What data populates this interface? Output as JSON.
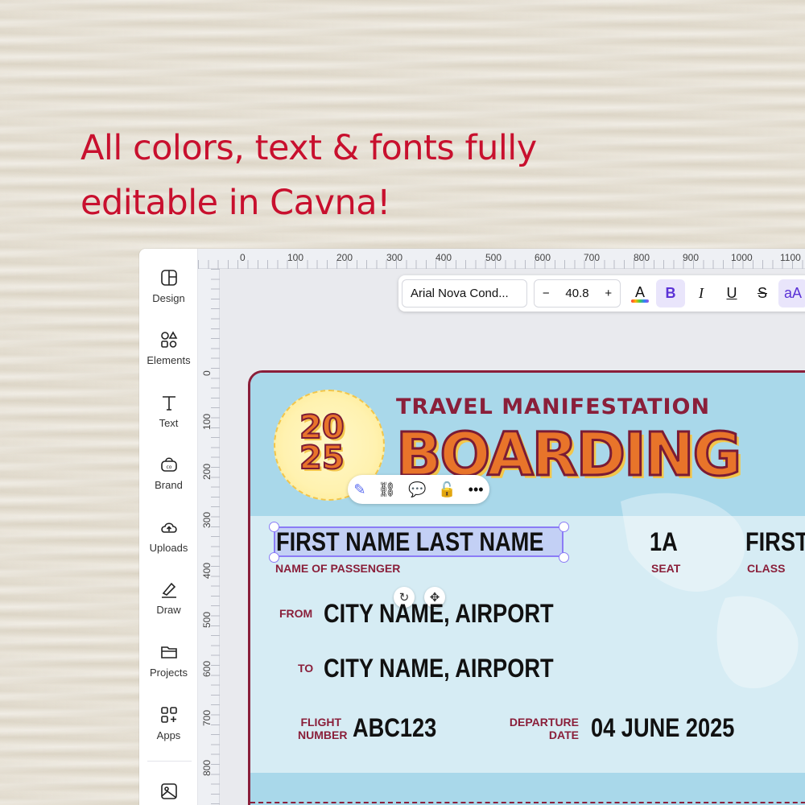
{
  "headline": "All colors, text & fonts fully editable in Cavna!",
  "sidebar": {
    "items": [
      {
        "label": "Design",
        "icon": "design-icon"
      },
      {
        "label": "Elements",
        "icon": "elements-icon"
      },
      {
        "label": "Text",
        "icon": "text-icon"
      },
      {
        "label": "Brand",
        "icon": "brand-icon"
      },
      {
        "label": "Uploads",
        "icon": "uploads-icon"
      },
      {
        "label": "Draw",
        "icon": "draw-icon"
      },
      {
        "label": "Projects",
        "icon": "projects-icon"
      },
      {
        "label": "Apps",
        "icon": "apps-icon"
      }
    ]
  },
  "ruler": {
    "top": [
      "0",
      "100",
      "200",
      "300",
      "400",
      "500",
      "600",
      "700",
      "800",
      "900",
      "1000",
      "1100"
    ],
    "left": [
      "0",
      "100",
      "200",
      "300",
      "400",
      "500",
      "600",
      "700",
      "800"
    ]
  },
  "toolbar": {
    "font_name": "Arial Nova Cond...",
    "minus": "−",
    "font_size": "40.8",
    "plus": "+",
    "color_letter": "A",
    "bold": "B",
    "italic": "I",
    "underline": "U",
    "strike": "S",
    "case": "aA"
  },
  "ticket": {
    "year_top": "20",
    "year_bottom": "25",
    "subtitle": "TRAVEL MANIFESTATION",
    "title": "BOARDING",
    "passenger_name": "FIRST NAME LAST NAME",
    "passenger_label": "NAME OF PASSENGER",
    "seat_value": "1A",
    "seat_label": "SEAT",
    "class_value": "FIRST",
    "class_label": "CLASS",
    "from_label": "FROM",
    "from_value": "CITY NAME, AIRPORT",
    "to_label": "TO",
    "to_value": "CITY NAME, AIRPORT",
    "flight_label_1": "FLIGHT",
    "flight_label_2": "NUMBER",
    "flight_value": "ABC123",
    "departure_label_1": "DEPARTURE",
    "departure_label_2": "DATE",
    "departure_value": "04 JUNE 2025"
  },
  "colors": {
    "headline": "#c8102e",
    "accent": "#8a1f3a",
    "orange": "#e8742a",
    "selection": "#8b7cf6"
  }
}
